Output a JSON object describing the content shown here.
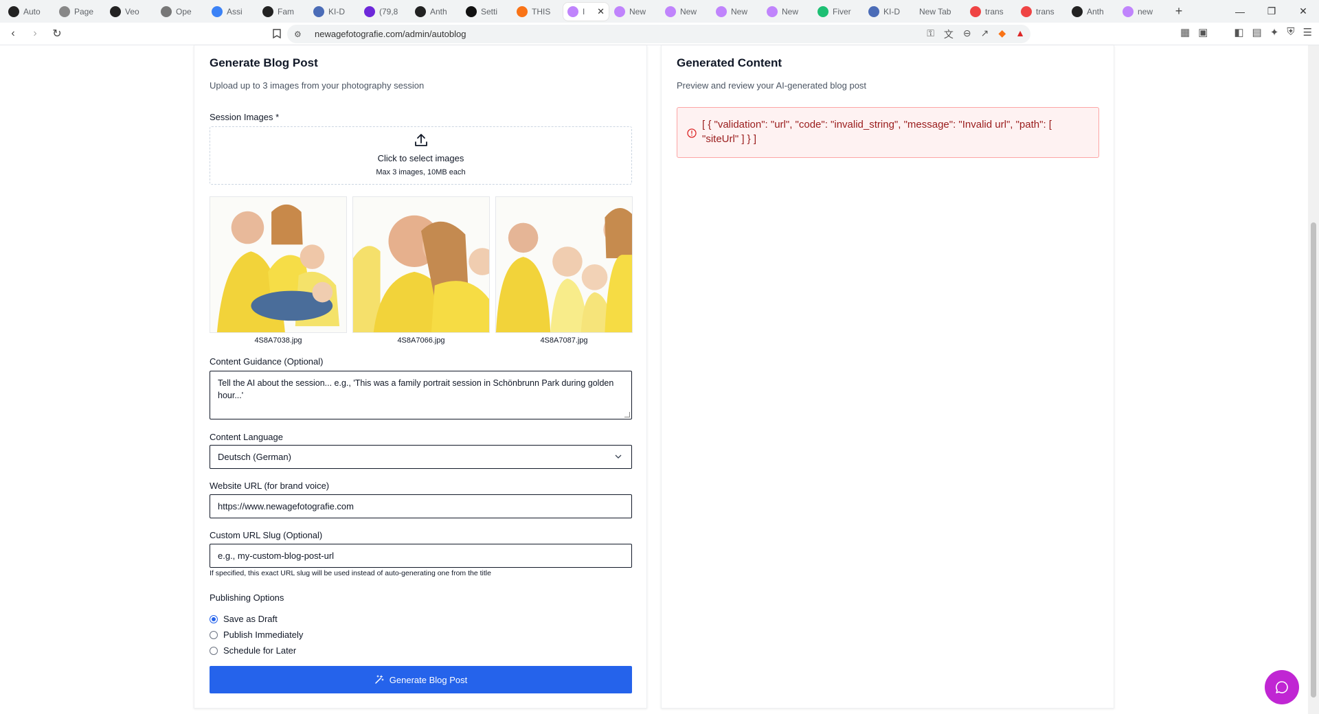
{
  "browser": {
    "tabs": [
      {
        "title": "Auto",
        "icon": "openai-icon",
        "color": "#222222"
      },
      {
        "title": "Page",
        "icon": "page-assist-icon",
        "color": "#888888"
      },
      {
        "title": "Veo",
        "icon": "openai-icon",
        "color": "#222222"
      },
      {
        "title": "Ope",
        "icon": "openai-icon",
        "color": "#777777"
      },
      {
        "title": "Assi",
        "icon": "assistant-icon",
        "color": "#3b82f6"
      },
      {
        "title": "Fam",
        "icon": "openai-icon",
        "color": "#222222"
      },
      {
        "title": "KI-D",
        "icon": "ki-icon",
        "color": "#4b6cb7"
      },
      {
        "title": "(79,8",
        "icon": "mail-icon",
        "color": "#6d28d9"
      },
      {
        "title": "Anth",
        "icon": "anthropic-icon",
        "color": "#222222"
      },
      {
        "title": "Setti",
        "icon": "settings-site-icon",
        "color": "#111111"
      },
      {
        "title": "THIS",
        "icon": "this-icon",
        "color": "#f97316"
      },
      {
        "title": "I",
        "icon": "newage-icon",
        "color": "#c084fc",
        "active": true
      },
      {
        "title": "New",
        "icon": "newage-icon",
        "color": "#c084fc"
      },
      {
        "title": "New",
        "icon": "newage-icon",
        "color": "#c084fc"
      },
      {
        "title": "New",
        "icon": "newage-icon",
        "color": "#c084fc"
      },
      {
        "title": "New",
        "icon": "newage-icon",
        "color": "#c084fc"
      },
      {
        "title": "Fiver",
        "icon": "fiverr-icon",
        "color": "#1dbf73"
      },
      {
        "title": "KI-D",
        "icon": "ki-icon",
        "color": "#4b6cb7"
      },
      {
        "title": "New Tab",
        "icon": "",
        "color": ""
      },
      {
        "title": "trans",
        "icon": "brave-icon",
        "color": "#ef4444"
      },
      {
        "title": "trans",
        "icon": "brave-icon",
        "color": "#ef4444"
      },
      {
        "title": "Anth",
        "icon": "anthropic-icon",
        "color": "#222222"
      },
      {
        "title": "new",
        "icon": "newage-icon",
        "color": "#c084fc"
      }
    ],
    "url": "newagefotografie.com/admin/autoblog"
  },
  "left": {
    "title": "Generate Blog Post",
    "subtitle": "Upload up to 3 images from your photography session",
    "images_label": "Session Images *",
    "dropzone_main": "Click to select images",
    "dropzone_sub": "Max 3 images, 10MB each",
    "images": [
      {
        "name": "4S8A7038.jpg"
      },
      {
        "name": "4S8A7066.jpg"
      },
      {
        "name": "4S8A7087.jpg"
      }
    ],
    "guidance_label": "Content Guidance (Optional)",
    "guidance_placeholder": "Tell the AI about the session... e.g., 'This was a family portrait session in Schönbrunn Park during golden hour...'",
    "language_label": "Content Language",
    "language_value": "Deutsch (German)",
    "website_label": "Website URL (for brand voice)",
    "website_value": "https://www.newagefotografie.com",
    "slug_label": "Custom URL Slug (Optional)",
    "slug_placeholder": "e.g., my-custom-blog-post-url",
    "slug_hint": "If specified, this exact URL slug will be used instead of auto-generating one from the title",
    "publishing_label": "Publishing Options",
    "publishing_options": [
      {
        "label": "Save as Draft",
        "checked": true
      },
      {
        "label": "Publish Immediately",
        "checked": false
      },
      {
        "label": "Schedule for Later",
        "checked": false
      }
    ],
    "generate_button": "Generate Blog Post"
  },
  "right": {
    "title": "Generated Content",
    "subtitle": "Preview and review your AI-generated blog post",
    "error": "[ { \"validation\": \"url\", \"code\": \"invalid_string\", \"message\": \"Invalid url\", \"path\": [ \"siteUrl\" ] } ]"
  },
  "colors": {
    "primary": "#2563eb",
    "error_text": "#991b1b",
    "error_bg": "#fef2f2",
    "chat_fab": "#c026d3"
  }
}
